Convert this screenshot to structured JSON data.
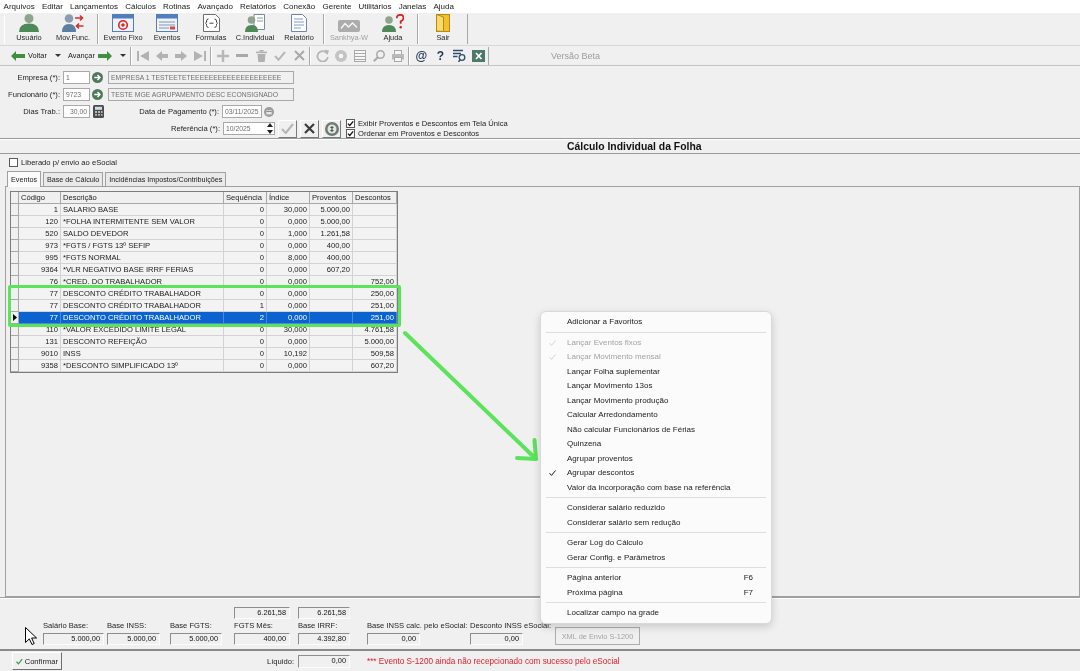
{
  "menu_bar": [
    "Arquivos",
    "Editar",
    "Lançamentos",
    "Cálculos",
    "Rotinas",
    "Avançado",
    "Relatórios",
    "Conexão",
    "Gerente",
    "Utilitários",
    "Janelas",
    "Ajuda"
  ],
  "main_toolbar": [
    [
      {
        "label": "Usuário",
        "disabled": false
      },
      {
        "label": "Mov.Func.",
        "disabled": false
      }
    ],
    [
      {
        "label": "Evento Fixo",
        "disabled": false
      },
      {
        "label": "Eventos",
        "disabled": false
      },
      {
        "label": "Fórmulas",
        "disabled": false
      },
      {
        "label": "C.Individual",
        "disabled": false
      },
      {
        "label": "Relatório",
        "disabled": false
      }
    ],
    [
      {
        "label": "Sankhya-W",
        "disabled": true
      },
      {
        "label": "Ajuda",
        "disabled": false
      }
    ],
    [
      {
        "label": "Sair",
        "disabled": false
      }
    ]
  ],
  "nav_toolbar": {
    "back": {
      "label": "Voltar"
    },
    "forward": {
      "label": "Avançar"
    },
    "tool_groups": [
      [
        {
          "disabled": true
        },
        {
          "disabled": true
        },
        {
          "disabled": true
        },
        {
          "disabled": true
        }
      ],
      [
        {
          "disabled": true
        },
        {
          "disabled": true
        },
        {
          "disabled": true
        },
        {
          "disabled": true
        },
        {
          "disabled": true
        }
      ],
      [
        {
          "disabled": true
        },
        {
          "disabled": true
        },
        {
          "disabled": true
        },
        {
          "disabled": true
        },
        {
          "disabled": true
        }
      ],
      [
        {
          "symbol": "@",
          "disabled": false
        },
        {
          "symbol": "?",
          "disabled": false
        },
        {
          "disabled": false
        },
        {
          "disabled": false
        }
      ]
    ]
  },
  "version_label": "Versão Beta",
  "form": {
    "company": {
      "label": "Empresa (*):",
      "code": "1",
      "name": "EMPRESA 1 TESTEETETEEEEEEEEEEEEEEEEEEEE"
    },
    "employee": {
      "label": "Funcionário (*):",
      "code": "9723",
      "name": "TESTE MGE AGRUPAMENTO DESC ECONSIGNADO"
    },
    "days_worked": {
      "label": "Dias Trab.:",
      "value": "30,00"
    },
    "payment_date": {
      "label": "Data de Pagamento (*):",
      "value": "03/11/2025"
    },
    "reference": {
      "label": "Referência (*):",
      "value": "10/2025"
    },
    "actions": [
      {
        "disabled": true
      },
      {
        "disabled": false
      },
      {
        "disabled": false
      }
    ],
    "options": [
      {
        "label": "Exibir Proventos e Descontos em Tela Única",
        "checked": true
      },
      {
        "label": "Ordenar em Proventos e Descontos",
        "checked": true
      }
    ]
  },
  "title": "Cálculo Individual da Folha",
  "esocial_release": {
    "label": "Liberado p/ envio ao eSocial",
    "checked": false
  },
  "tabs": [
    {
      "label": "Eventos",
      "selected": true
    },
    {
      "label": "Base de Cálculo",
      "selected": false
    },
    {
      "label": "Incidências Impostos/Contribuições",
      "selected": false
    }
  ],
  "table": {
    "columns": [
      "Código",
      "Descrição",
      "Sequência",
      "Índice",
      "Proventos",
      "Descontos"
    ],
    "rows": [
      {
        "code": "1",
        "description": "SALARIO BASE",
        "sequence": "0",
        "index": "30,000",
        "earnings": "5.000,00",
        "selected": false,
        "highlighted": false
      },
      {
        "code": "120",
        "description": "*FOLHA INTERMITENTE SEM VALOR",
        "sequence": "0",
        "index": "0,000",
        "earnings": "5.000,00",
        "selected": false,
        "highlighted": false
      },
      {
        "code": "520",
        "description": "SALDO DEVEDOR",
        "sequence": "0",
        "index": "1,000",
        "earnings": "1.261,58",
        "selected": false,
        "highlighted": false
      },
      {
        "code": "973",
        "description": "*FGTS / FGTS 13º SEFIP",
        "sequence": "0",
        "index": "0,000",
        "earnings": "400,00",
        "selected": false,
        "highlighted": false
      },
      {
        "code": "995",
        "description": "*FGTS NORMAL",
        "sequence": "0",
        "index": "8,000",
        "earnings": "400,00",
        "selected": false,
        "highlighted": false
      },
      {
        "code": "9364",
        "description": "*VLR NEGATIVO BASE IRRF FERIAS",
        "sequence": "0",
        "index": "0,000",
        "earnings": "607,20",
        "selected": false,
        "highlighted": false
      },
      {
        "code": "76",
        "description": "*CRED. DO TRABALHADOR",
        "sequence": "0",
        "index": "0,000",
        "deductions": "752,00",
        "selected": false,
        "highlighted": false
      },
      {
        "code": "77",
        "description": "DESCONTO CRÉDITO TRABALHADOR",
        "sequence": "0",
        "index": "0,000",
        "deductions": "250,00",
        "selected": false,
        "highlighted": true
      },
      {
        "code": "77",
        "description": "DESCONTO CRÉDITO TRABALHADOR",
        "sequence": "1",
        "index": "0,000",
        "deductions": "251,00",
        "selected": false,
        "highlighted": true
      },
      {
        "code": "77",
        "description": "DESCONTO CRÉDITO TRABALHADOR",
        "sequence": "2",
        "index": "0,000",
        "deductions": "251,00",
        "selected": true,
        "highlighted": true
      },
      {
        "code": "110",
        "description": "*VALOR EXCEDIDO LIMITE LEGAL",
        "sequence": "0",
        "index": "30,000",
        "deductions": "4.761,58",
        "selected": false,
        "highlighted": false
      },
      {
        "code": "131",
        "description": "DESCONTO REFEIÇÃO",
        "sequence": "0",
        "index": "0,000",
        "deductions": "5.000,00",
        "selected": false,
        "highlighted": false
      },
      {
        "code": "9010",
        "description": "INSS",
        "sequence": "0",
        "index": "10,192",
        "deductions": "509,58",
        "selected": false,
        "highlighted": false
      },
      {
        "code": "9358",
        "description": "*DESCONTO SIMPLIFICADO 13º",
        "sequence": "0",
        "index": "0,000",
        "deductions": "607,20",
        "selected": false,
        "highlighted": false
      }
    ]
  },
  "totals": {
    "unlabeled_values": [
      "6.261,58",
      "6.261,58"
    ],
    "fields": [
      {
        "label": "Salário Base:",
        "value": "5.000,00"
      },
      {
        "label": "Base INSS:",
        "value": "5.000,00"
      },
      {
        "label": "Base FGTS:",
        "value": "5.000,00"
      },
      {
        "label": "FGTS Mês:",
        "value": "400,00"
      },
      {
        "label": "Base IRRF:",
        "value": "4.392,80"
      },
      {
        "label": "Base INSS calc. pelo eSocial:",
        "value": "0,00"
      },
      {
        "label": "Desconto INSS eSocial:",
        "value": "0,00"
      }
    ],
    "xml_button": {
      "label": "XML de Envio S-1200",
      "disabled": true
    }
  },
  "footer": {
    "confirm_button": {
      "label": "Confirmar"
    },
    "net": {
      "label": "Líquido:",
      "value": "0,00"
    },
    "warning": "*** Evento S-1200 ainda não recepcionado com sucesso pelo eSocial"
  },
  "context_menu": {
    "sections": [
      [
        {
          "label": "Adicionar a Favoritos",
          "checked": false,
          "disabled": false
        }
      ],
      [
        {
          "label": "Lançar Eventos fixos",
          "checked": true,
          "disabled": true
        },
        {
          "label": "Lançar Movimento mensal",
          "checked": true,
          "disabled": true
        },
        {
          "label": "Lançar Folha suplementar",
          "checked": false,
          "disabled": false
        },
        {
          "label": "Lançar Movimento 13os",
          "checked": false,
          "disabled": false
        },
        {
          "label": "Lançar Movimento produção",
          "checked": false,
          "disabled": false
        },
        {
          "label": "Calcular Arredondamento",
          "checked": false,
          "disabled": false
        },
        {
          "label": "Não calcular Funcionários de Férias",
          "checked": false,
          "disabled": false
        },
        {
          "label": "Quinzena",
          "checked": false,
          "disabled": false
        },
        {
          "label": "Agrupar proventos",
          "checked": false,
          "disabled": false
        },
        {
          "label": "Agrupar descontos",
          "checked": true,
          "disabled": false
        },
        {
          "label": "Valor da incorporação com base na referência",
          "checked": false,
          "disabled": false
        }
      ],
      [
        {
          "label": "Considerar salário reduzido",
          "checked": false,
          "disabled": false
        },
        {
          "label": "Considerar salário sem redução",
          "checked": false,
          "disabled": false
        }
      ],
      [
        {
          "label": "Gerar Log do Cálculo",
          "checked": false,
          "disabled": false
        },
        {
          "label": "Gerar Config. e Parâmetros",
          "checked": false,
          "disabled": false
        }
      ],
      [
        {
          "label": "Página anterior",
          "shortcut": "F6",
          "checked": false,
          "disabled": false
        },
        {
          "label": "Próxima página",
          "shortcut": "F7",
          "checked": false,
          "disabled": false
        }
      ],
      [
        {
          "label": "Localizar campo na grade",
          "checked": false,
          "disabled": false
        }
      ]
    ]
  }
}
